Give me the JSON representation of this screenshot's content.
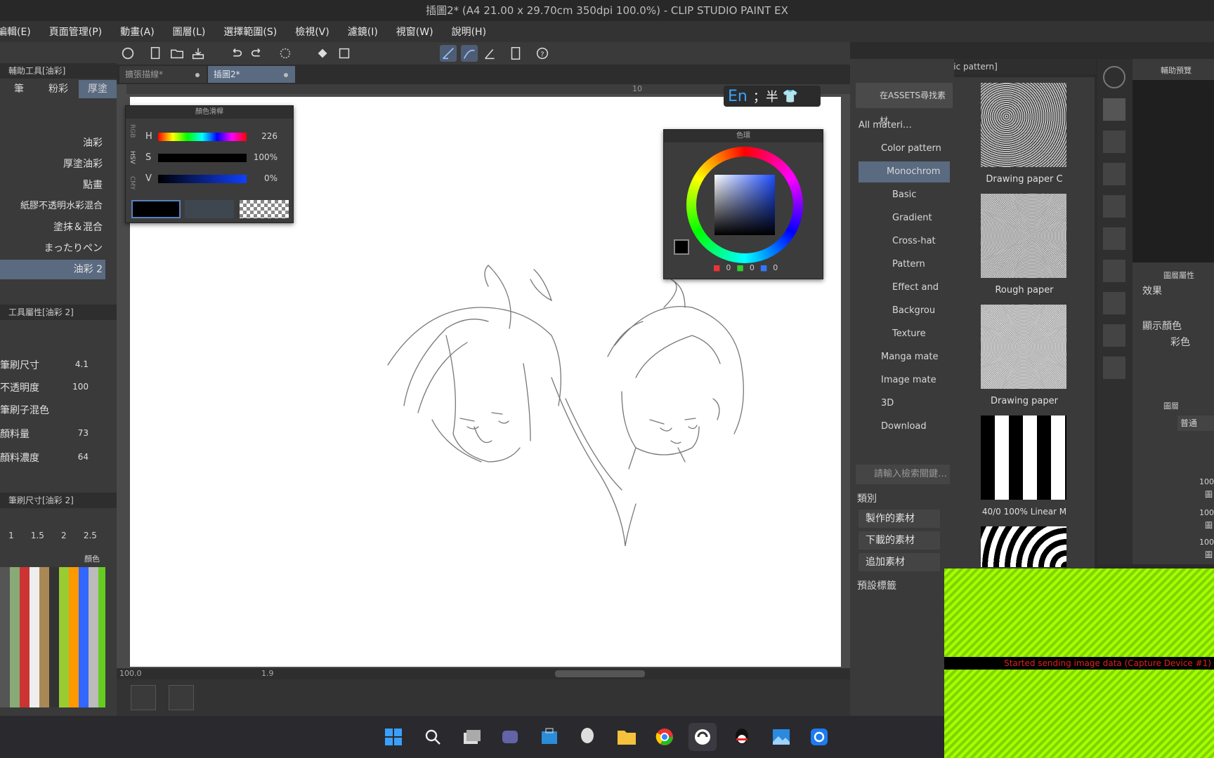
{
  "window": {
    "title": "插圖2* (A4 21.00 x 29.70cm 350dpi 100.0%) - CLIP STUDIO PAINT EX"
  },
  "menu": [
    "編輯(E)",
    "頁面管理(P)",
    "動畫(A)",
    "圖層(L)",
    "選擇範圍(S)",
    "檢視(V)",
    "濾鏡(I)",
    "視窗(W)",
    "說明(H)"
  ],
  "tabs": [
    {
      "label": "擴張描線*"
    },
    {
      "label": "插圖2*"
    }
  ],
  "ruler": {
    "mark": "10"
  },
  "ime": {
    "lang": "En",
    "mode": "；半"
  },
  "left": {
    "subtool_header": "輔助工具[油彩]",
    "subtool_tabs": [
      "筆",
      "粉彩",
      "厚塗"
    ],
    "brushes": [
      "油彩",
      "厚塗油彩",
      "點畫",
      "紙膠不透明水彩混合",
      "塗抹＆混合",
      "まったりペン",
      "油彩 2"
    ],
    "tool_prop_header": "工具屬性[油彩 2]",
    "props": [
      {
        "label": "筆刷尺寸",
        "value": "4.1"
      },
      {
        "label": "不透明度",
        "value": "100"
      },
      {
        "label": "筆刷子混色",
        "value": ""
      },
      {
        "label": "顏料量",
        "value": "73"
      },
      {
        "label": "顏料濃度",
        "value": "64"
      }
    ],
    "brush_size_header": "筆刷尺寸[油彩 2]",
    "sizes": [
      "1",
      "1.5",
      "2",
      "2.5"
    ],
    "color_set_label": "顏色"
  },
  "color_slider": {
    "title": "顏色滑桿",
    "modes": [
      "RGB",
      "HSV",
      "CMY"
    ],
    "rows": [
      {
        "label": "H",
        "value": "226"
      },
      {
        "label": "S",
        "value": "100%"
      },
      {
        "label": "V",
        "value": "0%"
      }
    ]
  },
  "color_wheel": {
    "title": "色環",
    "rgb": [
      "0",
      "0",
      "0"
    ]
  },
  "status": {
    "zoom": "100.0",
    "angle": "1.9"
  },
  "material": {
    "header": "素材[Monochromatic pattern]",
    "assets_btn": "在ASSETS尋找素材",
    "tree": [
      "All materi…",
      "Color pattern",
      "Monochrom",
      "Basic",
      "Gradient",
      "Cross-hat",
      "Pattern",
      "Effect and",
      "Backgrou",
      "Texture",
      "Manga mate",
      "Image mate",
      "3D",
      "Download"
    ],
    "search_placeholder": "請輸入檢索關鍵…",
    "category_label": "類別",
    "cat_buttons": [
      "製作的素材",
      "下載的素材",
      "追加素材"
    ],
    "tags_label": "預設標籤",
    "thumbs": [
      "Drawing paper C",
      "Rough paper",
      "Drawing paper",
      "40/0 100% Linear M"
    ]
  },
  "right": {
    "nav_header": "輔助預覽",
    "layer_prop_header": "圖層屬性",
    "effect_label": "效果",
    "display_color_label": "顯示顏色",
    "display_color_value": "彩色",
    "layer_header": "圖層",
    "blend_mode": "普通",
    "layer_opacity": [
      "100",
      "100",
      "100"
    ],
    "layer_type": [
      "圖",
      "圖",
      "圖"
    ]
  },
  "capture": {
    "message": "Started sending image data (Capture Device #1)"
  },
  "taskbar": {
    "icons": [
      "windows-start-icon",
      "search-icon",
      "task-view-icon",
      "teams-icon",
      "store-icon",
      "alien-icon",
      "file-explorer-icon",
      "chrome-icon",
      "clip-studio-icon",
      "qq-icon",
      "photos-icon",
      "app-icon"
    ]
  },
  "colors": {
    "accent_selected": "#5a6a80",
    "canvas_bg": "#4a4a4a",
    "capture_green": "#a6ff00"
  }
}
